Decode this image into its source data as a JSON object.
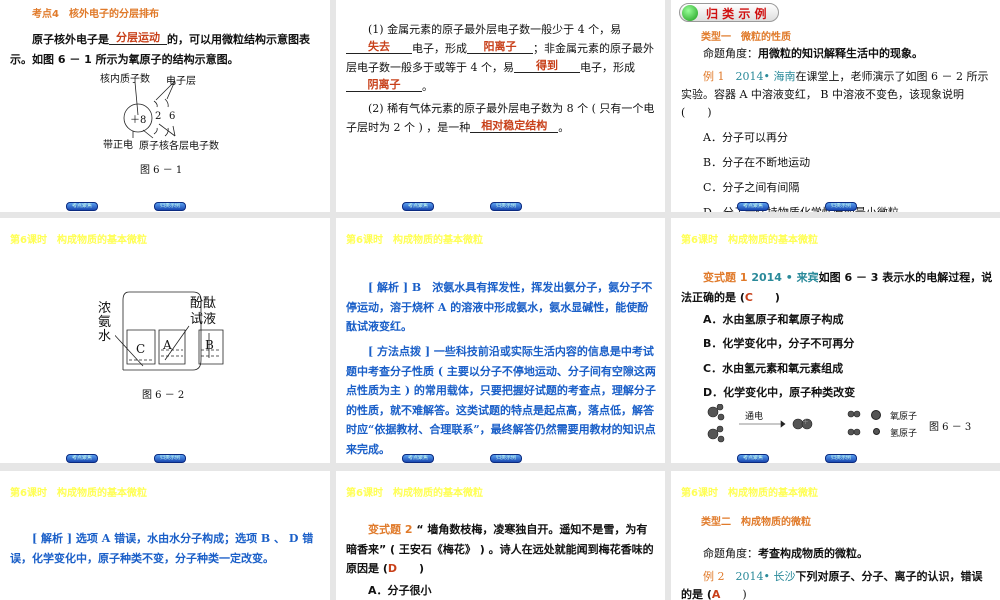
{
  "header": "第6课时　构成物质的基本微粒",
  "nav": {
    "prev": "考点聚焦",
    "next": "归类示例"
  },
  "s1": {
    "title": "考点4　核外电子的分层排布",
    "p1a": "原子核外电子是",
    "ans1": "分层运动",
    "p1b": "的，可以用微粒结构示意图表示。如图 6 － 1 所示为氧原子的结构示意图。",
    "lbl_proton": "核内质子数",
    "lbl_layer": "电子层",
    "nucleus": "＋8",
    "e1": "2",
    "e2": "6",
    "lbl_pos": "带正电",
    "lbl_core": "原子核",
    "lbl_count": "各层电子数",
    "caption": "图 6 － 1"
  },
  "s2": {
    "p1a": "(1) 金属元素的原子最外层电子数一般少于 4 个，易",
    "a1": "失去",
    "p1b": "电子，形成",
    "a2": "阳离子",
    "p1c": "；非金属元素的原子最外层电子数一般多于或等于 4 个，易",
    "a3": "得到",
    "p1d": "电子，形成",
    "a4": "阴离子",
    "p1e": "。",
    "p2a": "(2) 稀有气体元素的原子最外层电子数为 8 个 ( 只有一个电子层时为 2 个 ) ，是一种",
    "a5": "相对稳定结构",
    "p2b": "。"
  },
  "s3": {
    "badge": "归 类 示 例",
    "type": "类型一　微粒的性质",
    "angle_lbl": "命题角度：",
    "angle": "用微粒的知识解释生活中的现象。",
    "ex": "例 1",
    "src": "2014• 海南",
    "q": "在课堂上，老师演示了如图 6 － 2 所示实验。容器 A 中溶液变红， B 中溶液不变色，该现象说明 (　　)",
    "opts": [
      "A．分子可以再分",
      "B．分子在不断地运动",
      "C．分子之间有间隔",
      "D．分子是保持物质化学性质的最小微粒"
    ]
  },
  "s4": {
    "lbl_ammonia": "浓氨水",
    "lbl_phen": "酚酞试液",
    "a": "A",
    "b": "B",
    "c": "C",
    "caption": "图 6 － 2"
  },
  "s5": {
    "p1_tag": "[ 解析 ] B",
    "p1": "　浓氨水具有挥发性，挥发出氨分子，氨分子不停运动，溶于烧杯 A 的溶液中形成氨水，氨水显碱性，能使酚酞试液变红。",
    "p2_tag": "[ 方法点拨 ]",
    "p2": " 一些科技前沿或实际生活内容的信息是中考试题中考查分子性质 ( 主要以分子不停地运动、分子间有空隙这两点性质为主 ) 的常用载体，只要把握好试题的考查点，理解分子的性质，就不难解答。这类试题的特点是起点高，落点低，解答时应“依据教材、合理联系”，最终解答仍然需要用教材的知识点来完成。"
  },
  "s6": {
    "ex": "变式题 1",
    "src": "2014 • 来宾",
    "q": "如图 6 － 3 表示水的电解过程，说法正确的是 (",
    "ans": "C",
    "q2": "　　)",
    "opts": [
      "A．水由氢原子和氧原子构成",
      "B．化学变化中，分子不可再分",
      "C．水由氢元素和氧元素组成",
      "D．化学变化中，原子种类改变"
    ],
    "arrow": "通电",
    "plus": "+",
    "oxygen": "氧原子",
    "hydrogen": "氢原子",
    "caption": "图 6 － 3"
  },
  "s7": {
    "tag": "[ 解析 ]",
    "p": " 选项 A 错误，水由水分子构成；选项 B 、 D 错误，化学变化中，原子种类不变，分子种类一定改变。"
  },
  "s8": {
    "ex": "变式题 2",
    "q": "“ 墙角数枝梅，凌寒独自开。遥知不是雪，为有暗香来” ( 王安石《梅花》 ) 。诗人在远处就能闻到梅花香味的原因是 (",
    "ans": "D",
    "q2": "　　)",
    "opt": "A．分子很小"
  },
  "s9": {
    "type": "类型二　构成物质的微粒",
    "angle_lbl": "命题角度：",
    "angle": "考查构成物质的微粒。",
    "ex": "例 2",
    "src": "2014• 长沙",
    "q": "下列对原子、分子、离子的认识，错误的是 (",
    "ans": "A",
    "q2": "　　)"
  }
}
